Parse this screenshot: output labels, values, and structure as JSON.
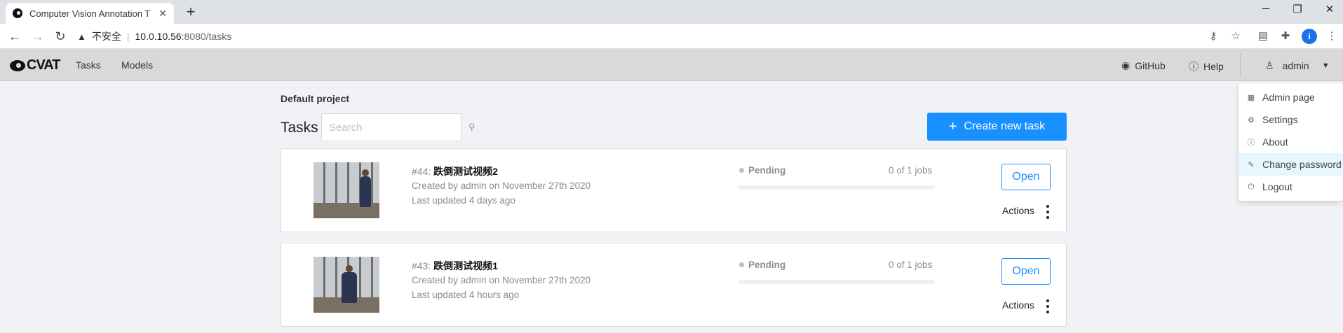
{
  "browser": {
    "tab_title": "Computer Vision Annotation T",
    "tab_close": "✕",
    "new_tab": "+",
    "url_warning_label": "不安全",
    "url_host": "10.0.10.56",
    "url_path": ":8080/tasks",
    "profile_initial": "i"
  },
  "header": {
    "logo_text": "CVAT",
    "nav": [
      "Tasks",
      "Models"
    ],
    "github_label": "GitHub",
    "help_label": "Help",
    "user_label": "admin"
  },
  "user_menu": {
    "items": [
      {
        "label": "Admin page",
        "icon": "admin-icon"
      },
      {
        "label": "Settings",
        "icon": "gear-icon"
      },
      {
        "label": "About",
        "icon": "info-icon"
      },
      {
        "label": "Change password",
        "icon": "edit-icon"
      },
      {
        "label": "Logout",
        "icon": "logout-icon"
      }
    ]
  },
  "page": {
    "project_title": "Default project",
    "tasks_title": "Tasks",
    "search_placeholder": "Search",
    "create_button_label": "Create new task"
  },
  "tasks": [
    {
      "id_label": "#44:",
      "name": "跌倒测试视频2",
      "created": "Created by admin on November 27th 2020",
      "updated": "Last updated 4 days ago",
      "status": "Pending",
      "jobs": "0 of 1 jobs",
      "progress": 0,
      "open_label": "Open",
      "actions_label": "Actions"
    },
    {
      "id_label": "#43:",
      "name": "跌倒测试视频1",
      "created": "Created by admin on November 27th 2020",
      "updated": "Last updated 4 hours ago",
      "status": "Pending",
      "jobs": "0 of 1 jobs",
      "progress": 0,
      "open_label": "Open",
      "actions_label": "Actions"
    }
  ],
  "colors": {
    "primary": "#1890ff",
    "header_bg": "#d9d9d9",
    "page_bg": "#f0f2f5"
  }
}
